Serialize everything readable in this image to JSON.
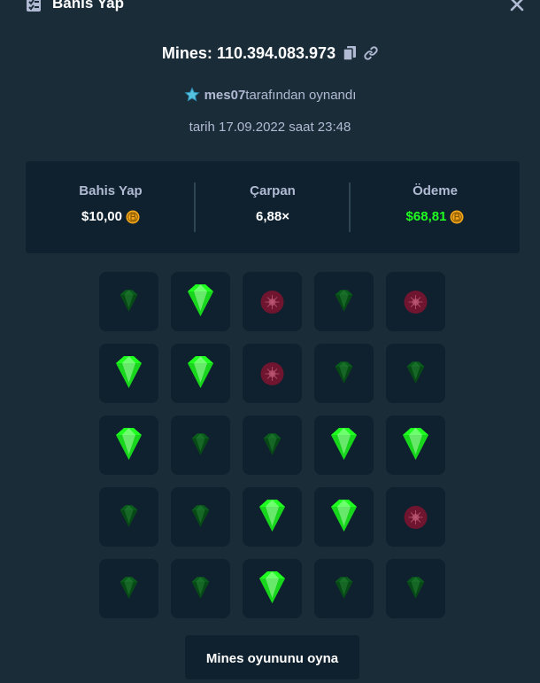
{
  "header": {
    "title": "Bahis Yap",
    "title_icon": "bet-slip-icon",
    "close_icon": "close-icon"
  },
  "game": {
    "prefix": "Mines:",
    "id": "110.394.083.973",
    "copy_icon": "copy-icon",
    "link_icon": "link-icon"
  },
  "player": {
    "name": "mes07",
    "suffix": "tarafından oynandı",
    "icon": "star-icon"
  },
  "date_line": "tarih 17.09.2022 saat 23:48",
  "stats": {
    "bet_label": "Bahis Yap",
    "bet_value": "$10,00",
    "multiplier_label": "Çarpan",
    "multiplier_value": "6,88×",
    "payout_label": "Ödeme",
    "payout_value": "$68,81",
    "payout_color": "#1fff20",
    "coin_icon": "bitcoin-coin-icon"
  },
  "grid": {
    "rows": 5,
    "cols": 5,
    "tiles": [
      "gem",
      "gem-picked",
      "mine",
      "gem",
      "mine",
      "gem-picked",
      "gem-picked",
      "mine",
      "gem",
      "gem",
      "gem-picked",
      "gem",
      "gem",
      "gem-picked",
      "gem-picked",
      "gem",
      "gem",
      "gem-picked",
      "gem-picked",
      "mine",
      "gem",
      "gem",
      "gem-picked",
      "gem",
      "gem"
    ]
  },
  "play_button": "Mines oyununu oyna",
  "colors": {
    "background": "#1a2c38",
    "panel": "#0f212e",
    "text_muted": "#b1bad3",
    "gem_bright": "#1fff20",
    "gem_dim": "#0a5c1c",
    "mine": "#7a1430"
  }
}
